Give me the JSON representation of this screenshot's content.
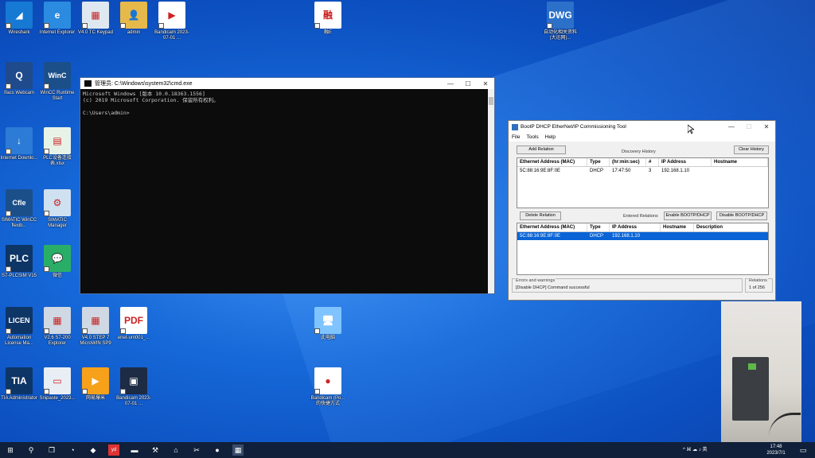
{
  "desktop_icons": [
    {
      "label": "Wireshark",
      "glyph": "◢",
      "color": "#1679d3"
    },
    {
      "label": "Internet Explorer",
      "glyph": "e",
      "color": "#2a8be0"
    },
    {
      "label": "V4.0 TC Keypad",
      "glyph": "▦",
      "color": "#dfe7f0"
    },
    {
      "label": "admin",
      "glyph": "👤",
      "color": "#e7b94a"
    },
    {
      "label": "Bandicam 2023-07-01 ...",
      "glyph": "▶",
      "color": "#ffffff"
    },
    {
      "label": "Ifacs Webcam",
      "glyph": "Q",
      "color": "#1f4a8c"
    },
    {
      "label": "WinCC Runtime Start",
      "glyph": "WinC",
      "color": "#1b4f8a"
    },
    {
      "label": "Internet Downlo...",
      "glyph": "↓",
      "color": "#2c7bd6"
    },
    {
      "label": "PLC设备连接表.xlsx",
      "glyph": "▤",
      "color": "#e8f3e8"
    },
    {
      "label": "SIMATIC WinCC flexib...",
      "glyph": "Cfle",
      "color": "#1b4f8a"
    },
    {
      "label": "SIMATIC Manager",
      "glyph": "⚙",
      "color": "#cfe0f0"
    },
    {
      "label": "S7-PLCSIM V15",
      "glyph": "PLC",
      "color": "#0d3566"
    },
    {
      "label": "微信",
      "glyph": "💬",
      "color": "#2aae67"
    },
    {
      "label": "Automation License Ma...",
      "glyph": "LICEN",
      "color": "#0d3566"
    },
    {
      "label": "V2.6 S7-200 Explorer",
      "glyph": "▦",
      "color": "#cfd8e3"
    },
    {
      "label": "V4.0 STEP 7 MicroWIN SP9",
      "glyph": "▦",
      "color": "#cfd8e3"
    },
    {
      "label": "enet-um001_...",
      "glyph": "PDF",
      "color": "#ffffff"
    },
    {
      "label": "TIA Administrator",
      "glyph": "TIA",
      "color": "#0d3566"
    },
    {
      "label": "Snipaste_2023...",
      "glyph": "▭",
      "color": "#e9eef5"
    },
    {
      "label": "网易爆米",
      "glyph": "▶",
      "color": "#f7a11a"
    },
    {
      "label": "Bandicam 2023-07-01 ...",
      "glyph": "▣",
      "color": "#1d2b44"
    },
    {
      "label": "融E",
      "glyph": "融",
      "color": "#ffffff"
    },
    {
      "label": "此电脑",
      "glyph": "🖥",
      "color": "#7fc3ff"
    },
    {
      "label": "Bandicam (Po... 的快捷方式",
      "glyph": "●",
      "color": "#ffffff"
    },
    {
      "label": "自动化相关资料(大迅网)...",
      "glyph": "DWG",
      "color": "#2b70c9"
    }
  ],
  "cmd": {
    "title": "管理员: C:\\Windows\\system32\\cmd.exe",
    "lines": [
      "Microsoft Windows [版本 10.0.18363.1556]",
      "(c) 2019 Microsoft Corporation. 保留所有权利。",
      "",
      "C:\\Users\\admin>"
    ]
  },
  "bootp": {
    "title": "BootP DHCP EtherNet/IP Commissioning Tool",
    "menu": [
      "File",
      "Tools",
      "Help"
    ],
    "add_relation": "Add Relation",
    "discovery_history": "Discovery History",
    "clear_history": "Clear History",
    "history_columns": [
      "Ethernet Address (MAC)",
      "Type",
      "(hr:min:sec)",
      "#",
      "IP Address",
      "Hostname"
    ],
    "history_rows": [
      [
        "5C:88:16:9E:8F:0E",
        "DHCP",
        "17:47:50",
        "3",
        "192.168.1.10",
        ""
      ]
    ],
    "delete_relation": "Delete Relation",
    "entered_relations": "Entered Relations",
    "enable_bootp": "Enable BOOTP/DHCP",
    "disable_bootp": "Disable BOOTP/DHCP",
    "relation_columns": [
      "Ethernet Address (MAC)",
      "Type",
      "IP Address",
      "Hostname",
      "Description"
    ],
    "relation_rows": [
      [
        "5C:88:16:9E:8F:0E",
        "DHCP",
        "192.168.1.10",
        "",
        ""
      ]
    ],
    "errors_label": "Errors and warnings",
    "status_message": "[Disable DHCP] Command successful",
    "relations_label": "Relations",
    "relations_count": "1 of 256"
  },
  "taskbar": {
    "clock_time": "17:48",
    "clock_date": "2023/7/1",
    "tray": "^ ⌘ ☁ ♪ 英"
  }
}
